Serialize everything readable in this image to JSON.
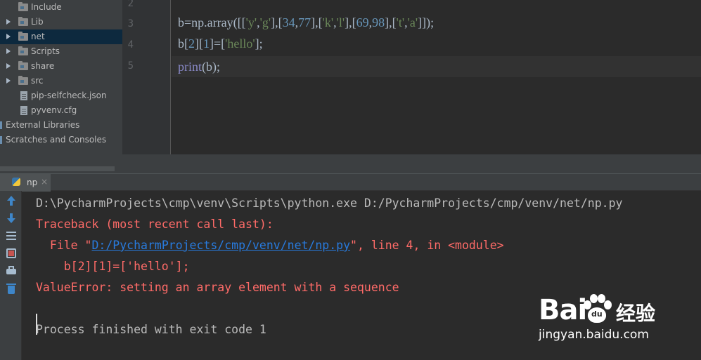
{
  "project_tree": {
    "items": [
      {
        "label": "Include",
        "kind": "folder",
        "expandable": false
      },
      {
        "label": "Lib",
        "kind": "folder",
        "expandable": true
      },
      {
        "label": "net",
        "kind": "folder",
        "expandable": true,
        "selected": true
      },
      {
        "label": "Scripts",
        "kind": "folder",
        "expandable": true
      },
      {
        "label": "share",
        "kind": "folder",
        "expandable": true
      },
      {
        "label": "src",
        "kind": "folder",
        "expandable": true
      },
      {
        "label": "pip-selfcheck.json",
        "kind": "file"
      },
      {
        "label": "pyvenv.cfg",
        "kind": "file"
      },
      {
        "label": "External Libraries",
        "kind": "root"
      },
      {
        "label": "Scratches and Consoles",
        "kind": "root"
      }
    ]
  },
  "editor": {
    "line_numbers": [
      "2",
      "3",
      "4",
      "5"
    ],
    "lines": [
      {
        "no": "3",
        "text": "b=np.array([['y','g'],[34,77],['k','l'],[69,98],['t','a']]);"
      },
      {
        "no": "4",
        "text": "b[2][1]=['hello'];"
      },
      {
        "no": "5",
        "text": "print(b);"
      }
    ]
  },
  "run_panel": {
    "tab_label": "np",
    "tab_close": "×",
    "toolbar": [
      "up-arrow-icon",
      "down-arrow-icon",
      "soft-wrap-icon",
      "scroll-to-end-icon",
      "print-icon",
      "trash-icon"
    ],
    "console": {
      "command": "D:\\PycharmProjects\\cmp\\venv\\Scripts\\python.exe D:/PycharmProjects/cmp/venv/net/np.py",
      "traceback_header": "Traceback (most recent call last):",
      "file_prefix": "  File \"",
      "file_link": "D:/PycharmProjects/cmp/venv/net/np.py",
      "file_suffix": "\", line 4, in <module>",
      "error_source": "    b[2][1]=['hello'];",
      "error_message": "ValueError: setting an array element with a sequence",
      "exit_message": "Process finished with exit code 1"
    }
  },
  "watermark": {
    "brand": "Bai",
    "paw_text": "du",
    "product": "经验",
    "url": "jingyan.baidu.com"
  },
  "colors": {
    "error": "#ff6b68",
    "link": "#287bde",
    "string": "#6a8759",
    "number": "#6897bb",
    "builtin": "#8888c6"
  }
}
